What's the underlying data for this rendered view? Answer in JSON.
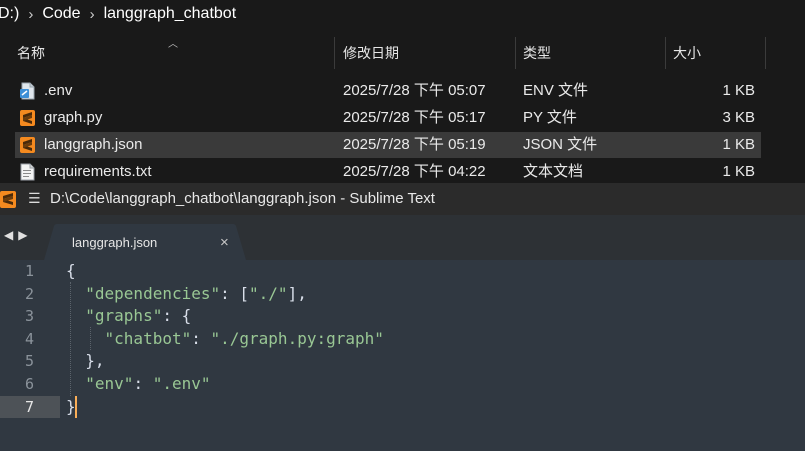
{
  "explorer": {
    "breadcrumb": {
      "drive": "D:)",
      "folder": "Code",
      "subfolder": "langgraph_chatbot"
    },
    "columns": {
      "name": "名称",
      "date": "修改日期",
      "type": "类型",
      "size": "大小"
    },
    "files": [
      {
        "icon": "env-file-icon",
        "name": ".env",
        "date": "2025/7/28 下午 05:07",
        "type": "ENV 文件",
        "size": "1 KB",
        "selected": false
      },
      {
        "icon": "sublime-file-icon",
        "name": "graph.py",
        "date": "2025/7/28 下午 05:17",
        "type": "PY 文件",
        "size": "3 KB",
        "selected": false
      },
      {
        "icon": "sublime-file-icon",
        "name": "langgraph.json",
        "date": "2025/7/28 下午 05:19",
        "type": "JSON 文件",
        "size": "1 KB",
        "selected": true
      },
      {
        "icon": "text-file-icon",
        "name": "requirements.txt",
        "date": "2025/7/28 下午 04:22",
        "type": "文本文档",
        "size": "1 KB",
        "selected": false
      }
    ]
  },
  "sublime": {
    "title": "D:\\Code\\langgraph_chatbot\\langgraph.json - Sublime Text",
    "tab_label": "langgraph.json",
    "tab_close": "×",
    "line_numbers": [
      "1",
      "2",
      "3",
      "4",
      "5",
      "6",
      "7"
    ],
    "current_line": 7,
    "code": {
      "l1": "{",
      "l2_key": "\"dependencies\"",
      "l2_rest": ": [",
      "l2_val": "\"./\"",
      "l2_end": "],",
      "l3_key": "\"graphs\"",
      "l3_rest": ": {",
      "l4_key": "\"chatbot\"",
      "l4_rest": ": ",
      "l4_val": "\"./graph.py:graph\"",
      "l5": "},",
      "l6_key": "\"env\"",
      "l6_rest": ": ",
      "l6_val": "\".env\"",
      "l7": "}"
    }
  },
  "colors": {
    "accent_orange": "#f9ae58",
    "string_green": "#99c794",
    "editor_bg": "#303841"
  }
}
